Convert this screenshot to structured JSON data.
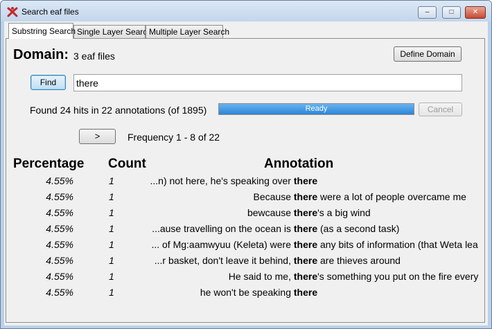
{
  "window": {
    "title": "Search eaf files",
    "min_glyph": "–",
    "max_glyph": "□",
    "close_glyph": "✕"
  },
  "tabs": [
    {
      "label": "Substring Search",
      "active": true
    },
    {
      "label": "Single Layer Search",
      "active": false
    },
    {
      "label": "Multiple Layer Search",
      "active": false
    }
  ],
  "domain": {
    "label": "Domain:",
    "value": "3 eaf files",
    "define_button": "Define Domain"
  },
  "search": {
    "find_button": "Find",
    "query": "there"
  },
  "status": {
    "found_text": "Found 24 hits in 22 annotations (of 1895)",
    "progress_label": "Ready",
    "progress_fraction": 1.0,
    "cancel_button": "Cancel"
  },
  "pager": {
    "next_button": ">",
    "frequency_text": "Frequency 1 - 8 of 22"
  },
  "table": {
    "headers": {
      "percentage": "Percentage",
      "count": "Count",
      "annotation": "Annotation"
    },
    "rows": [
      {
        "pct": "4.55%",
        "count": "1",
        "pre": "...n) not here, he's speaking over ",
        "hit": "there",
        "post": ""
      },
      {
        "pct": "4.55%",
        "count": "1",
        "pre": "Because ",
        "hit": "there",
        "post": " were a lot of people overcame me"
      },
      {
        "pct": "4.55%",
        "count": "1",
        "pre": "bewcause ",
        "hit": "there",
        "post": "'s a big wind"
      },
      {
        "pct": "4.55%",
        "count": "1",
        "pre": "...ause travelling on the ocean is ",
        "hit": "there",
        "post": " (as a second task)"
      },
      {
        "pct": "4.55%",
        "count": "1",
        "pre": "... of Mg:aamwyuu (Keleta) were ",
        "hit": "there",
        "post": " any bits of information (that Weta lea"
      },
      {
        "pct": "4.55%",
        "count": "1",
        "pre": "...r basket, don't leave it behind, ",
        "hit": "there",
        "post": " are thieves around"
      },
      {
        "pct": "4.55%",
        "count": "1",
        "pre": "He said to me, ",
        "hit": "there",
        "post": "'s something you put on the fire every"
      },
      {
        "pct": "4.55%",
        "count": "1",
        "pre": "he won't be speaking ",
        "hit": "there",
        "post": ""
      }
    ]
  }
}
